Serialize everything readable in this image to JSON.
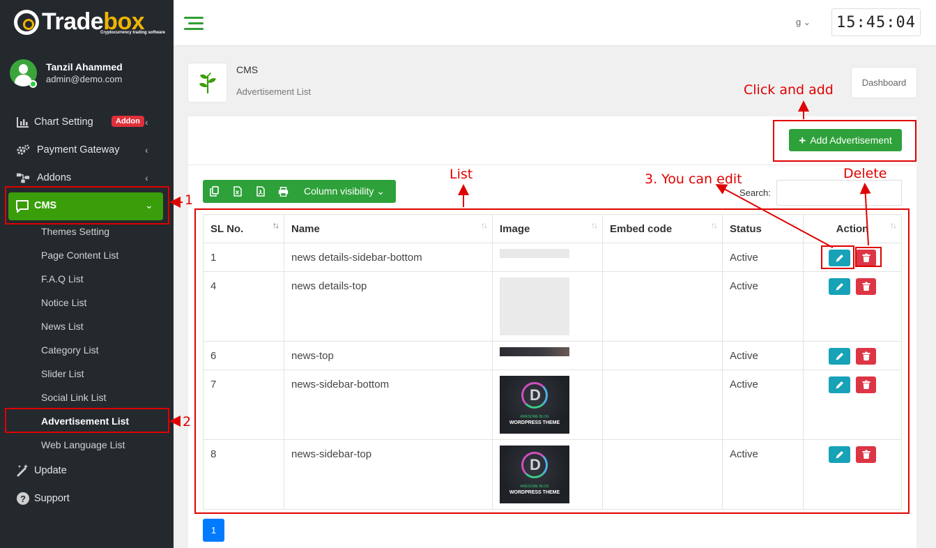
{
  "brand": {
    "logo_text_a": "Trade",
    "logo_text_b": "box",
    "logo_sub": "Cryptocurrency trading software"
  },
  "user": {
    "name": "Tanzil Ahammed",
    "email": "admin@demo.com"
  },
  "sidebar": {
    "items": [
      {
        "label": "Chart Setting",
        "icon": "bar-chart-icon",
        "badge": "Addon"
      },
      {
        "label": "Payment Gateway",
        "icon": "gears-icon"
      },
      {
        "label": "Addons",
        "icon": "sitemap-icon"
      },
      {
        "label": "CMS",
        "icon": "comment-icon"
      }
    ],
    "cms_sub": [
      "Themes Setting",
      "Page Content List",
      "F.A.Q List",
      "Notice List",
      "News List",
      "Category List",
      "Slider List",
      "Social Link List",
      "Advertisement List",
      "Web Language List"
    ],
    "bottom": [
      {
        "label": "Update",
        "icon": "magic-wand-icon"
      },
      {
        "label": "Support",
        "icon": "question-circle-icon"
      }
    ]
  },
  "topbar": {
    "language": "g",
    "clock": "15:45:04"
  },
  "page": {
    "title": "CMS",
    "subtitle": "Advertisement List",
    "dashboard_button": "Dashboard"
  },
  "toolbar": {
    "add_button": "Add Advertisement",
    "column_visibility": "Column visibility",
    "search_label": "Search:",
    "search_value": ""
  },
  "table": {
    "headers": [
      "SL No.",
      "Name",
      "Image",
      "Embed code",
      "Status",
      "Action"
    ],
    "rows": [
      {
        "sl": "1",
        "name": "news details-sidebar-bottom",
        "embed": "",
        "status": "Active",
        "image": "strip-light"
      },
      {
        "sl": "4",
        "name": "news details-top",
        "embed": "",
        "status": "Active",
        "image": "box-light"
      },
      {
        "sl": "6",
        "name": "news-top",
        "embed": "",
        "status": "Active",
        "image": "strip-dark"
      },
      {
        "sl": "7",
        "name": "news-sidebar-bottom",
        "embed": "",
        "status": "Active",
        "image": "wordpress-theme"
      },
      {
        "sl": "8",
        "name": "news-sidebar-top",
        "embed": "",
        "status": "Active",
        "image": "wordpress-theme"
      }
    ],
    "theme_banner_line1": "AWESOME BLOG",
    "theme_banner_line2": "WORDPRESS THEME"
  },
  "pagination": {
    "current": "1"
  },
  "annotations": {
    "step1": "1",
    "step2": "2",
    "list": "List",
    "edit": "3. You can edit",
    "delete": "Delete",
    "add": "Click and add"
  },
  "colors": {
    "sidebar_bg": "#24292e",
    "accent_green": "#2ea13a",
    "edit_blue": "#17a2b8",
    "delete_red": "#dc3545",
    "annotation_red": "#e00000",
    "pager_blue": "#007bff"
  }
}
